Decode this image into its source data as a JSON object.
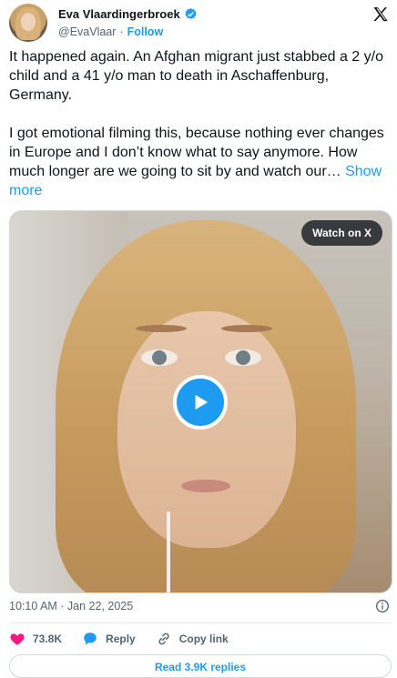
{
  "author": {
    "display_name": "Eva Vlaardingerbroek",
    "handle": "@EvaVlaar",
    "separator": "·",
    "follow_label": "Follow"
  },
  "tweet": {
    "paragraph_1": "It happened again. An Afghan migrant just stabbed a 2 y/o child and a 41 y/o man to death in Aschaffenburg, Germany.",
    "paragraph_2": "I got emotional filming this, because nothing ever changes in Europe and I don’t know what to say anymore. How much longer are we going to sit by and watch our…",
    "show_more_label": "Show more"
  },
  "media": {
    "watch_label": "Watch on X"
  },
  "meta": {
    "timestamp": "10:10 AM · Jan 22, 2025"
  },
  "actions": {
    "likes": "73.8K",
    "reply_label": "Reply",
    "copy_link_label": "Copy link"
  },
  "footer": {
    "read_replies_label": "Read 3.9K replies"
  },
  "colors": {
    "accent": "#1d9bf0",
    "like": "#f91880",
    "text": "#0f1419",
    "muted": "#536471"
  }
}
